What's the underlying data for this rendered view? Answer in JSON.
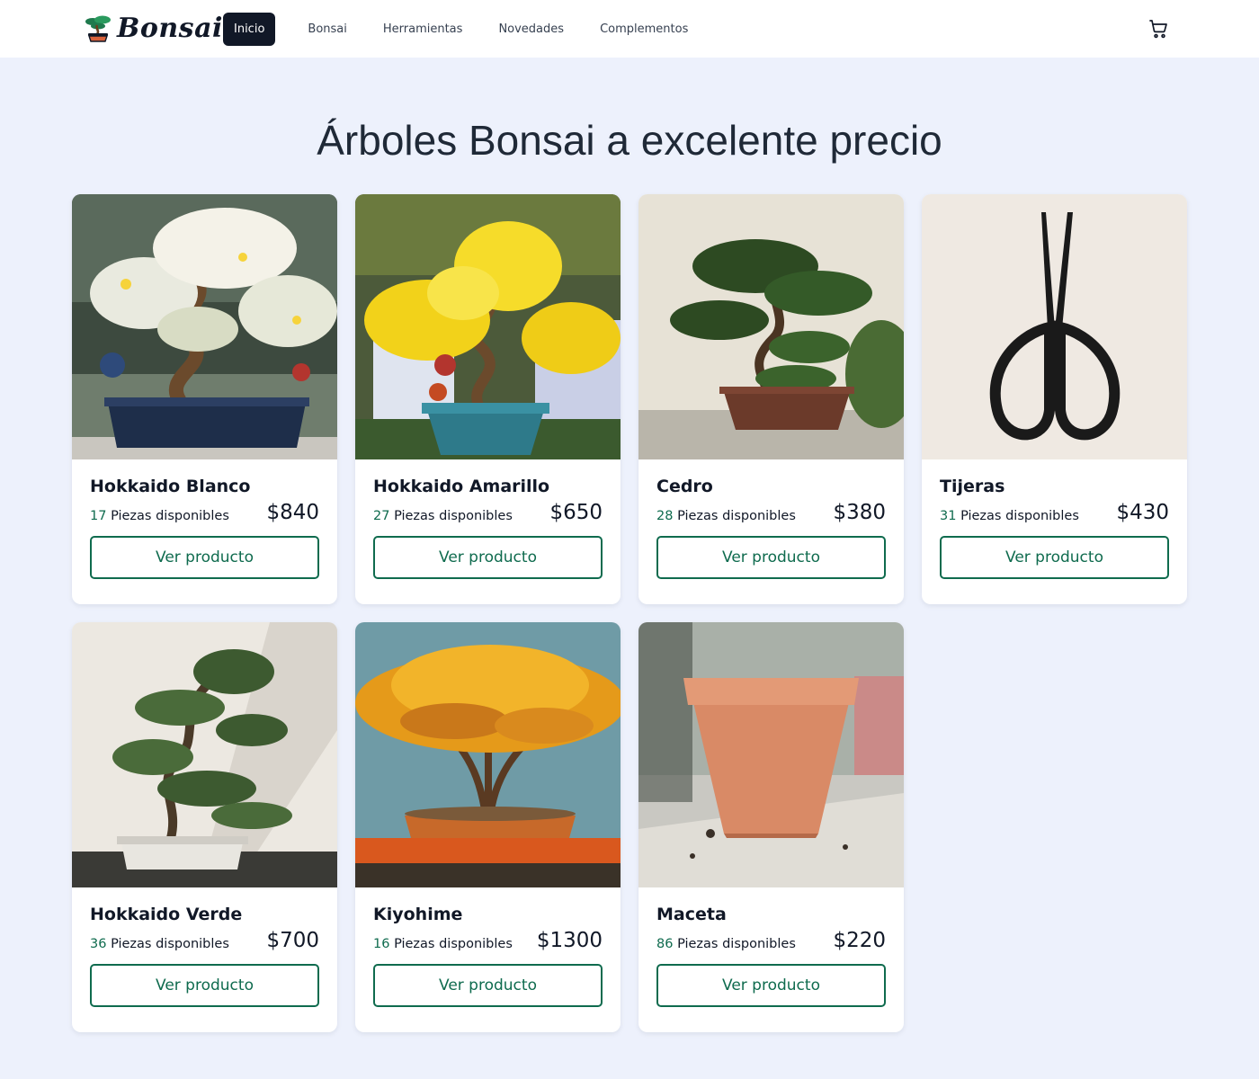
{
  "nav": {
    "brand": "Bonsai",
    "links": [
      {
        "label": "Inicio",
        "active": true
      },
      {
        "label": "Bonsai",
        "active": false
      },
      {
        "label": "Herramientas",
        "active": false
      },
      {
        "label": "Novedades",
        "active": false
      },
      {
        "label": "Complementos",
        "active": false
      }
    ],
    "cart_icon": "shopping-cart-icon"
  },
  "hero": {
    "title": "Árboles Bonsai a excelente precio"
  },
  "colors": {
    "accent": "#0f6b4e",
    "nav_active": "#111827",
    "background": "#edf1fc"
  },
  "products": [
    {
      "name": "Hokkaido Blanco",
      "stock": "17",
      "stock_label": "Piezas disponibles",
      "price": "$840",
      "button": "Ver producto",
      "image": "white-flowering-bonsai"
    },
    {
      "name": "Hokkaido Amarillo",
      "stock": "27",
      "stock_label": "Piezas disponibles",
      "price": "$650",
      "button": "Ver producto",
      "image": "yellow-flowering-bonsai"
    },
    {
      "name": "Cedro",
      "stock": "28",
      "stock_label": "Piezas disponibles",
      "price": "$380",
      "button": "Ver producto",
      "image": "cedar-bonsai"
    },
    {
      "name": "Tijeras",
      "stock": "31",
      "stock_label": "Piezas disponibles",
      "price": "$430",
      "button": "Ver producto",
      "image": "pruning-scissors"
    },
    {
      "name": "Hokkaido Verde",
      "stock": "36",
      "stock_label": "Piezas disponibles",
      "price": "$700",
      "button": "Ver producto",
      "image": "green-bonsai"
    },
    {
      "name": "Kiyohime",
      "stock": "16",
      "stock_label": "Piezas disponibles",
      "price": "$1300",
      "button": "Ver producto",
      "image": "orange-maple-bonsai"
    },
    {
      "name": "Maceta",
      "stock": "86",
      "stock_label": "Piezas disponibles",
      "price": "$220",
      "button": "Ver producto",
      "image": "terracotta-pot"
    }
  ]
}
